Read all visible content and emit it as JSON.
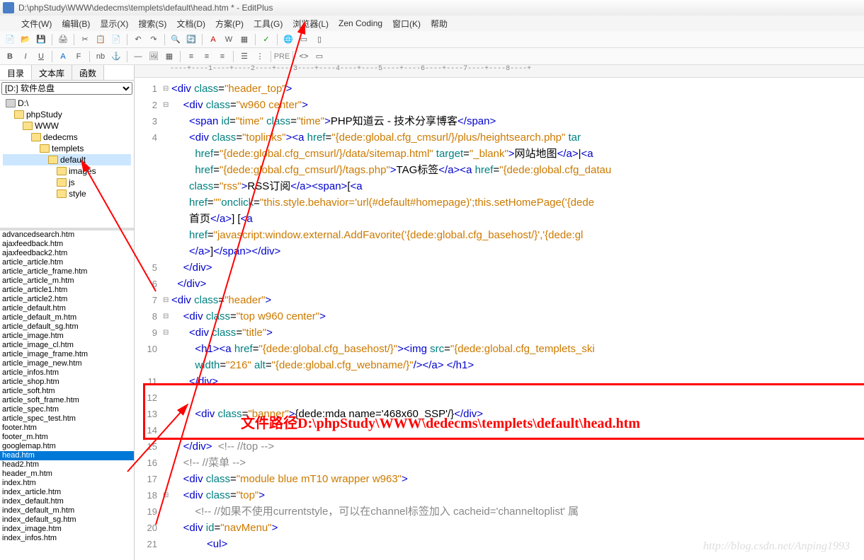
{
  "title": "D:\\phpStudy\\WWW\\dedecms\\templets\\default\\head.htm * - EditPlus",
  "menus": [
    "文件(W)",
    "编辑(B)",
    "显示(X)",
    "搜索(S)",
    "文档(D)",
    "方案(P)",
    "工具(G)",
    "浏览器(L)",
    "Zen Coding",
    "窗口(K)",
    "帮助"
  ],
  "sidebar": {
    "tabs": [
      "目录",
      "文本库",
      "函数"
    ],
    "combo": "[D:] 软件总盘",
    "tree": [
      {
        "label": "D:\\",
        "indent": 0,
        "icon": "drive"
      },
      {
        "label": "phpStudy",
        "indent": 1,
        "icon": "folder"
      },
      {
        "label": "WWW",
        "indent": 2,
        "icon": "folder"
      },
      {
        "label": "dedecms",
        "indent": 3,
        "icon": "folder"
      },
      {
        "label": "templets",
        "indent": 4,
        "icon": "folder"
      },
      {
        "label": "default",
        "indent": 5,
        "icon": "folder",
        "sel": true
      },
      {
        "label": "images",
        "indent": 6,
        "icon": "folder"
      },
      {
        "label": "js",
        "indent": 6,
        "icon": "folder"
      },
      {
        "label": "style",
        "indent": 6,
        "icon": "folder"
      }
    ],
    "files": [
      "advancedsearch.htm",
      "ajaxfeedback.htm",
      "ajaxfeedback2.htm",
      "article_article.htm",
      "article_article_frame.htm",
      "article_article_m.htm",
      "article_article1.htm",
      "article_article2.htm",
      "article_default.htm",
      "article_default_m.htm",
      "article_default_sg.htm",
      "article_image.htm",
      "article_image_cl.htm",
      "article_image_frame.htm",
      "article_image_new.htm",
      "article_infos.htm",
      "article_shop.htm",
      "article_soft.htm",
      "article_soft_frame.htm",
      "article_spec.htm",
      "article_spec_test.htm",
      "footer.htm",
      "footer_m.htm",
      "googlemap.htm",
      "head.htm",
      "head2.htm",
      "header_m.htm",
      "index.htm",
      "index_article.htm",
      "index_default.htm",
      "index_default_m.htm",
      "index_default_sg.htm",
      "index_image.htm",
      "index_infos.htm"
    ],
    "selected_file": "head.htm"
  },
  "ruler": "----+----1----+----2----+----3----+----4----+----5----+----6----+----7----+----8----+",
  "code_lines": [
    {
      "n": 1,
      "f": "⊟",
      "html": "<span class='t-tag'>&lt;div</span> <span class='t-attr'>class</span>=<span class='t-str'>\"header_top\"</span><span class='t-tag'>&gt;</span>"
    },
    {
      "n": 2,
      "f": "⊟",
      "html": "    <span class='t-tag'>&lt;div</span> <span class='t-attr'>class</span>=<span class='t-str'>\"w960 center\"</span><span class='t-tag'>&gt;</span>"
    },
    {
      "n": 3,
      "f": "",
      "html": "      <span class='t-tag'>&lt;span</span> <span class='t-attr'>id</span>=<span class='t-str'>\"time\"</span> <span class='t-attr'>class</span>=<span class='t-str'>\"time\"</span><span class='t-tag'>&gt;</span><span class='t-cn'>PHP知道云 - 技术分享博客</span><span class='t-tag'>&lt;/span&gt;</span>"
    },
    {
      "n": 4,
      "f": "",
      "html": "      <span class='t-tag'>&lt;div</span> <span class='t-attr'>class</span>=<span class='t-str'>\"toplinks\"</span><span class='t-tag'>&gt;&lt;a</span> <span class='t-attr'>href</span>=<span class='t-str'>\"{dede:global.cfg_cmsurl/}/plus/heightsearch.php\"</span> <span class='t-attr'>tar</span>"
    },
    {
      "n": "",
      "f": "",
      "html": "        <span class='t-attr'>href</span>=<span class='t-str'>\"{dede:global.cfg_cmsurl/}/data/sitemap.html\"</span> <span class='t-attr'>target</span>=<span class='t-str'>\"_blank\"</span><span class='t-tag'>&gt;</span><span class='t-cn'>网站地图</span><span class='t-tag'>&lt;/a&gt;</span>|<span class='t-tag'>&lt;a</span>"
    },
    {
      "n": "",
      "f": "",
      "html": "        <span class='t-attr'>href</span>=<span class='t-str'>\"{dede:global.cfg_cmsurl/}/tags.php\"</span><span class='t-tag'>&gt;</span><span class='t-cn'>TAG标签</span><span class='t-tag'>&lt;/a&gt;&lt;a</span> <span class='t-attr'>href</span>=<span class='t-str'>\"{dede:global.cfg_datau</span>"
    },
    {
      "n": "",
      "f": "",
      "html": "      <span class='t-attr'>class</span>=<span class='t-str'>\"rss\"</span><span class='t-tag'>&gt;</span><span class='t-cn'>RSS订阅</span><span class='t-tag'>&lt;/a&gt;&lt;span&gt;</span>[<span class='t-tag'>&lt;a</span>"
    },
    {
      "n": "",
      "f": "",
      "html": "      <span class='t-attr'>href</span>=<span class='t-str'>\"\"</span><span class='t-attr'>onclick</span>=<span class='t-str'>\"this.style.behavior='url(#default#homepage)';this.setHomePage('{dede</span>"
    },
    {
      "n": "",
      "f": "",
      "html": "      <span class='t-cn'>首页</span><span class='t-tag'>&lt;/a&gt;</span>] [<span class='t-tag'>&lt;a</span>"
    },
    {
      "n": "",
      "f": "",
      "html": "      <span class='t-attr'>href</span>=<span class='t-str'>\"javascript:window.external.AddFavorite('{dede:global.cfg_basehost/}','{dede:gl</span>"
    },
    {
      "n": "",
      "f": "",
      "html": "      <span class='t-tag'>&lt;/a&gt;</span>]<span class='t-tag'>&lt;/span&gt;&lt;/div&gt;</span>"
    },
    {
      "n": 5,
      "f": "",
      "html": "    <span class='t-tag'>&lt;/div&gt;</span>"
    },
    {
      "n": 6,
      "f": "",
      "html": "  <span class='t-tag'>&lt;/div&gt;</span>"
    },
    {
      "n": 7,
      "f": "⊟",
      "html": "<span class='t-tag'>&lt;div</span> <span class='t-attr'>class</span>=<span class='t-str'>\"header\"</span><span class='t-tag'>&gt;</span>"
    },
    {
      "n": 8,
      "f": "⊟",
      "html": "    <span class='t-tag'>&lt;div</span> <span class='t-attr'>class</span>=<span class='t-str'>\"top w960 center\"</span><span class='t-tag'>&gt;</span>"
    },
    {
      "n": 9,
      "f": "⊟",
      "html": "      <span class='t-tag'>&lt;div</span> <span class='t-attr'>class</span>=<span class='t-str'>\"title\"</span><span class='t-tag'>&gt;</span>"
    },
    {
      "n": 10,
      "f": "",
      "html": "        <span class='t-tag'>&lt;h1&gt;&lt;a</span> <span class='t-attr'>href</span>=<span class='t-str'>\"{dede:global.cfg_basehost/}\"</span><span class='t-tag'>&gt;&lt;img</span> <span class='t-attr'>src</span>=<span class='t-str'>\"{dede:global.cfg_templets_ski</span>"
    },
    {
      "n": "",
      "f": "",
      "html": "        <span class='t-attr'>width</span>=<span class='t-str'>\"216\"</span> <span class='t-attr'>alt</span>=<span class='t-str'>\"{dede:global.cfg_webname/}\"</span><span class='t-tag'>/&gt;&lt;/a&gt; &lt;/h1&gt;</span>"
    },
    {
      "n": 11,
      "f": "",
      "html": "      <span class='t-tag'>&lt;/div&gt;</span>"
    },
    {
      "n": 12,
      "f": "",
      "html": ""
    },
    {
      "n": 13,
      "f": "",
      "html": "        <span class='t-tag'>&lt;div</span> <span class='t-attr'>class</span>=<span class='t-str'>\"banner\"</span><span class='t-tag'>&gt;</span>{dede:mda name='468x60_SSP'/}<span class='t-tag'>&lt;/div&gt;</span>"
    },
    {
      "n": 14,
      "f": "",
      "html": ""
    },
    {
      "n": 15,
      "f": "",
      "html": "    <span class='t-tag'>&lt;/div&gt;</span>  <span class='t-cmt'>&lt;!-- //top --&gt;</span>"
    },
    {
      "n": 16,
      "f": "",
      "html": "    <span class='t-cmt'>&lt;!-- //菜单 --&gt;</span>"
    },
    {
      "n": 17,
      "f": "",
      "html": "    <span class='t-tag'>&lt;div</span> <span class='t-attr'>class</span>=<span class='t-str'>\"module blue mT10 wrapper w963\"</span><span class='t-tag'>&gt;</span>"
    },
    {
      "n": 18,
      "f": "⊟",
      "html": "    <span class='t-tag'>&lt;div</span> <span class='t-attr'>class</span>=<span class='t-str'>\"top\"</span><span class='t-tag'>&gt;</span>"
    },
    {
      "n": 19,
      "f": "",
      "html": "        <span class='t-cmt'>&lt;!-- //如果不使用currentstyle，可以在channel标签加入 cacheid='channeltoplist' 属</span>"
    },
    {
      "n": 20,
      "f": "",
      "html": "    <span class='t-tag'>&lt;div</span> <span class='t-attr'>id</span>=<span class='t-str'>\"navMenu\"</span><span class='t-tag'>&gt;</span>"
    },
    {
      "n": 21,
      "f": "",
      "html": "            <span class='t-tag'>&lt;ul&gt;</span>"
    }
  ],
  "annotation": "文件路径D:\\phpStudy\\WWW\\dedecms\\templets\\default\\head.htm",
  "watermark": "http://blog.csdn.net/Anping1993"
}
